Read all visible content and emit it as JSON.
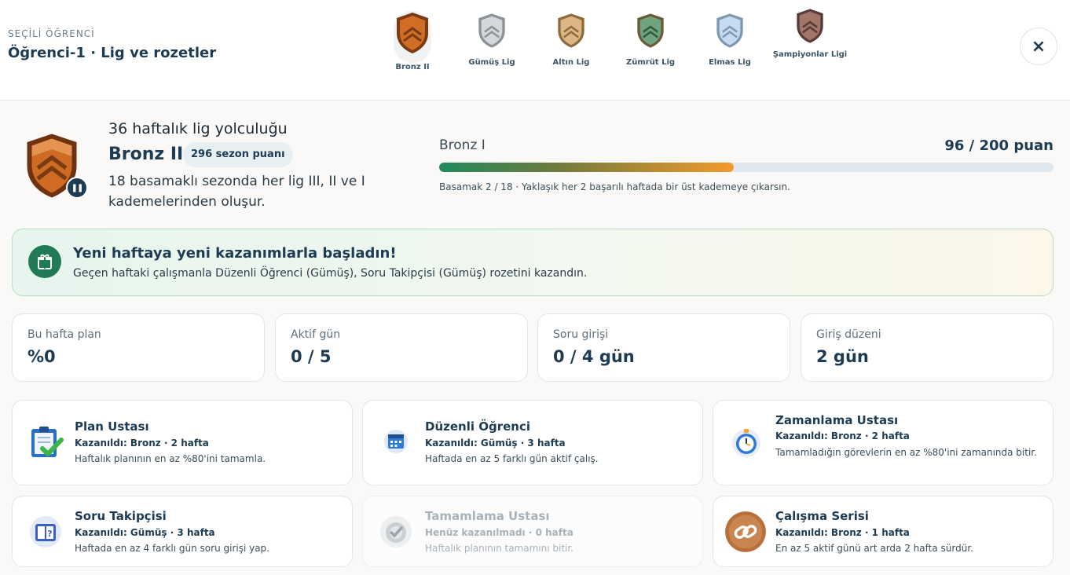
{
  "header": {
    "selected_label": "SEÇİLİ ÖĞRENCİ",
    "title": "Öğrenci-1 · Lig ve rozetler",
    "close_icon": "×"
  },
  "leagues": [
    {
      "name": "Bronz II",
      "color": "#c2651f",
      "active": true
    },
    {
      "name": "Gümüş Lig",
      "color": "#b9bec3",
      "active": false
    },
    {
      "name": "Altın Lig",
      "color": "#c9a06a",
      "active": false
    },
    {
      "name": "Zümrüt Lig",
      "color": "#5c8f6b",
      "active": false
    },
    {
      "name": "Elmas Lig",
      "color": "#a9c6e0",
      "active": false
    },
    {
      "name": "Şampiyonlar Ligi",
      "color": "#8d6257",
      "active": false
    }
  ],
  "summary": {
    "journey": "36 haftalık lig yolculuğu",
    "rank": "Bronz II",
    "season_points": "296 sezon puanı",
    "description": "18 basamaklı sezonda her lig III, II ve I kademelerinden oluşur.",
    "pause_icon": "pause-icon"
  },
  "progress": {
    "next_rank": "Bronz I",
    "points": "96 / 200 puan",
    "fraction": 0.48,
    "note": "Basamak 2 / 18 · Yaklaşık her 2 başarılı haftada bir üst kademeye çıkarsın."
  },
  "banner": {
    "icon": "gift-icon",
    "title": "Yeni haftaya yeni kazanımlarla başladın!",
    "text": "Geçen haftaki çalışmanla Düzenli Öğrenci (Gümüş), Soru Takipçisi (Gümüş) rozetini kazandın."
  },
  "stats": [
    {
      "label": "Bu hafta plan",
      "value": "%0"
    },
    {
      "label": "Aktif gün",
      "value": "0 / 5"
    },
    {
      "label": "Soru girişi",
      "value": "0 / 4 gün"
    },
    {
      "label": "Giriş düzeni",
      "value": "2 gün"
    }
  ],
  "badges": [
    {
      "title": "Plan Ustası",
      "status": "Kazanıldı: Bronz · 2 hafta",
      "desc": "Haftalık planının en az %80'ini tamamla.",
      "icon": "clipboard-check-icon"
    },
    {
      "title": "Düzenli Öğrenci",
      "status": "Kazanıldı: Gümüş · 3 hafta",
      "desc": "Haftada en az 5 farklı gün aktif çalış.",
      "icon": "calendar-icon"
    },
    {
      "title": "Zamanlama Ustası",
      "status": "Kazanıldı: Bronz · 2 hafta",
      "desc": "Tamamladığın görevlerin en az %80'ini zamanında bitir.",
      "icon": "stopwatch-icon"
    },
    {
      "title": "Soru Takipçisi",
      "status": "Kazanıldı: Gümüş · 3 hafta",
      "desc": "Haftada en az 4 farklı gün soru girişi yap.",
      "icon": "question-book-icon"
    },
    {
      "title": "Tamamlama Ustası",
      "status": "Henüz kazanılmadı · 0 hafta",
      "desc": "Haftalık planının tamamını bitir.",
      "icon": "target-icon"
    },
    {
      "title": "Çalışma Serisi",
      "status": "Kazanıldı: Bronz · 1 hafta",
      "desc": "En az 5 aktif günü art arda 2 hafta sürdür.",
      "icon": "chain-link-icon"
    }
  ]
}
